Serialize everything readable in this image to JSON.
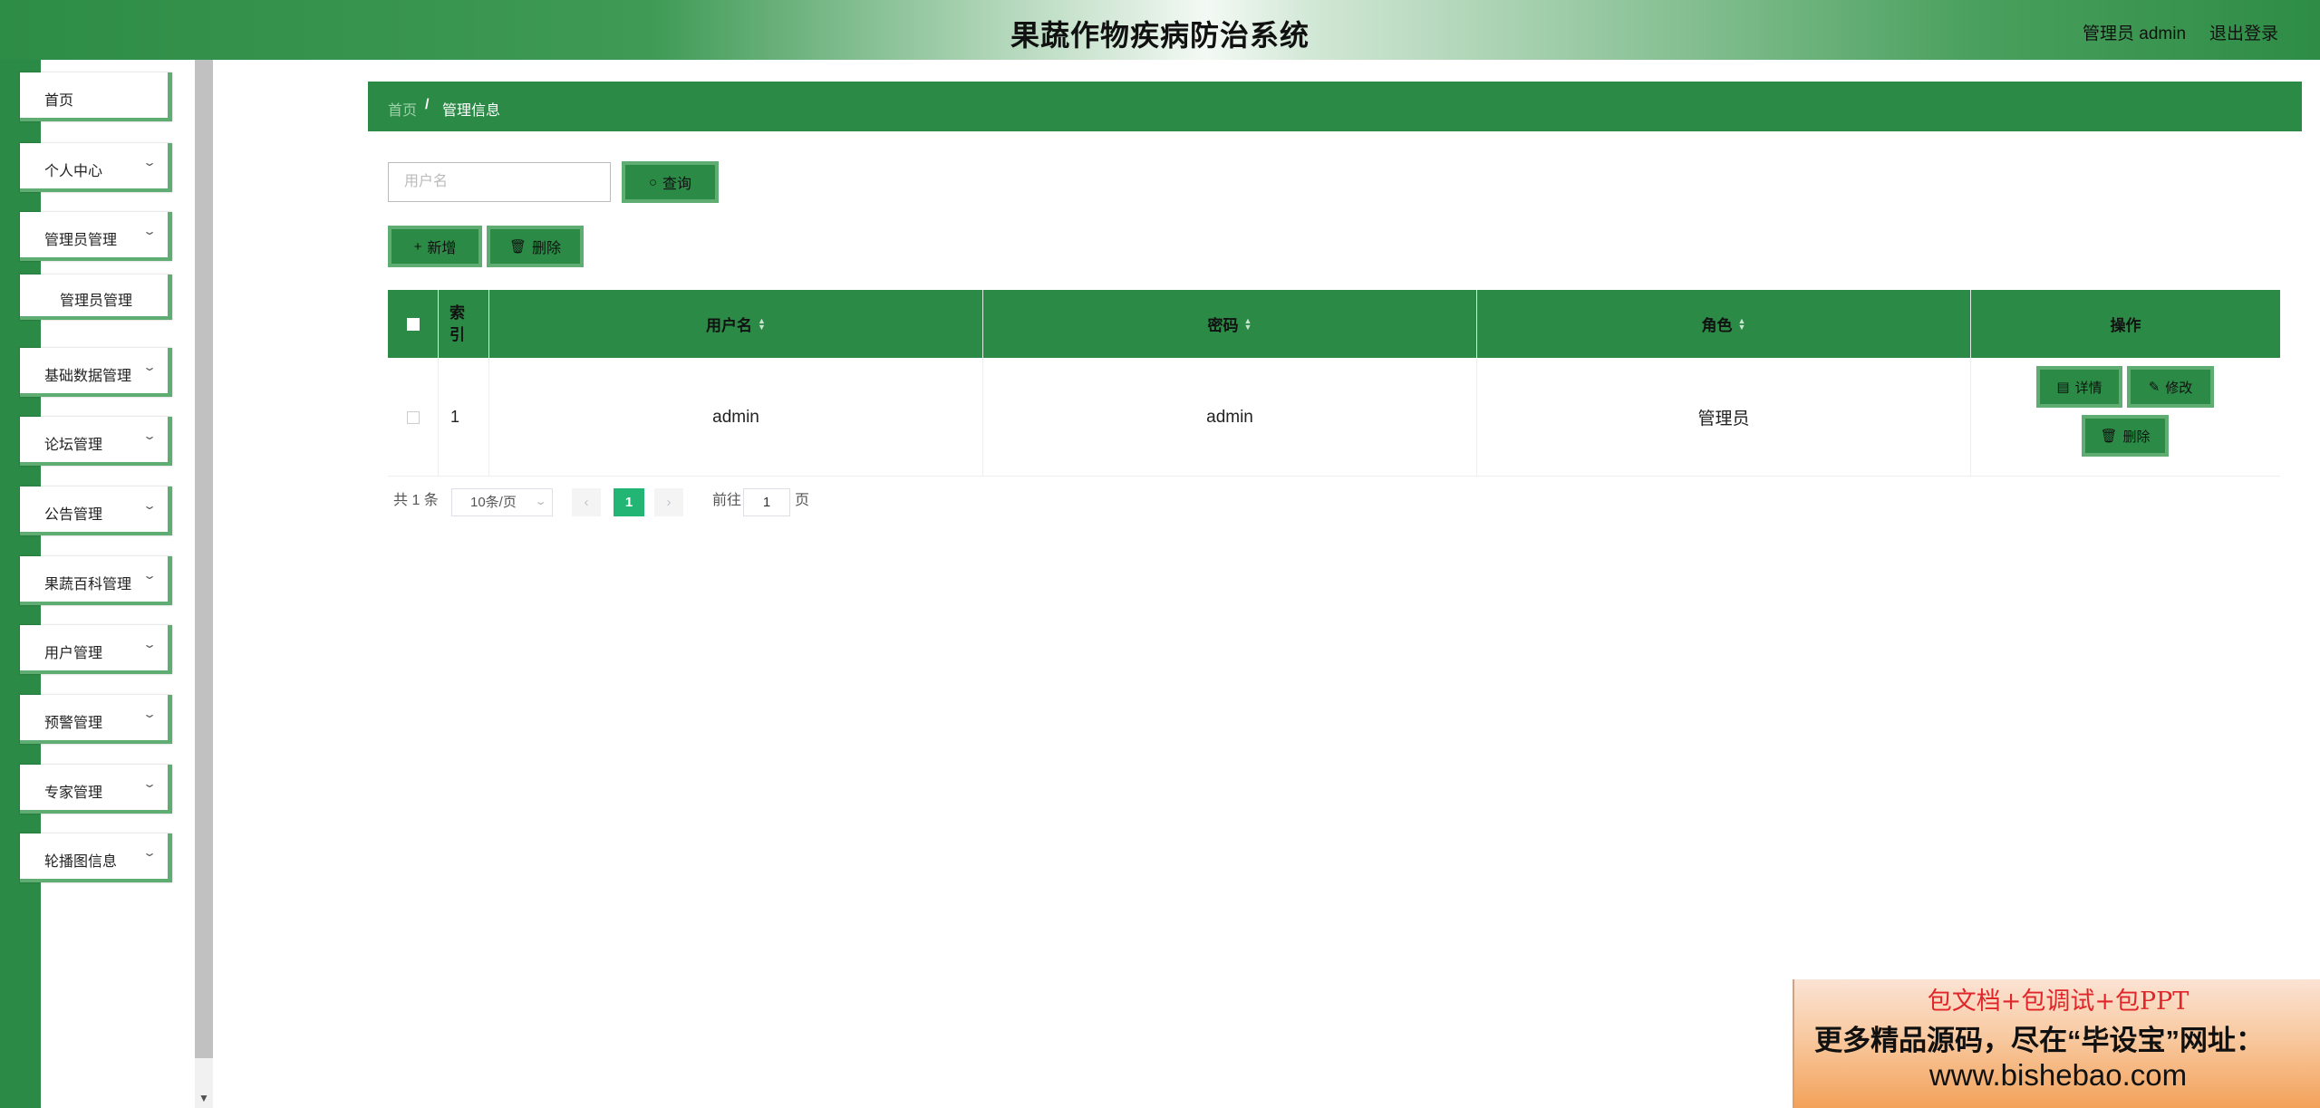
{
  "header": {
    "title": "果蔬作物疾病防治系统",
    "user": "管理员 admin",
    "logout": "退出登录"
  },
  "sidebar": {
    "items": [
      {
        "label": "首页",
        "expandable": false
      },
      {
        "label": "个人中心",
        "expandable": true
      },
      {
        "label": "管理员管理",
        "expandable": true
      },
      {
        "label": "管理员管理",
        "sub": true
      },
      {
        "label": "基础数据管理",
        "expandable": true
      },
      {
        "label": "论坛管理",
        "expandable": true
      },
      {
        "label": "公告管理",
        "expandable": true
      },
      {
        "label": "果蔬百科管理",
        "expandable": true
      },
      {
        "label": "用户管理",
        "expandable": true
      },
      {
        "label": "预警管理",
        "expandable": true
      },
      {
        "label": "专家管理",
        "expandable": true
      },
      {
        "label": "轮播图信息",
        "expandable": true
      }
    ]
  },
  "breadcrumb": {
    "home": "首页",
    "separator": "/",
    "current": "管理信息"
  },
  "search": {
    "placeholder": "用户名",
    "value": "",
    "button": "查询"
  },
  "toolbar": {
    "add": "新增",
    "delete": "删除"
  },
  "table": {
    "columns": {
      "index": "索引",
      "username": "用户名",
      "password": "密码",
      "role": "角色",
      "actions": "操作"
    },
    "rows": [
      {
        "index": "1",
        "username": "admin",
        "password": "admin",
        "role": "管理员"
      }
    ],
    "row_actions": {
      "detail": "详情",
      "edit": "修改",
      "delete": "删除"
    }
  },
  "pagination": {
    "total": "共 1 条",
    "page_size": "10条/页",
    "current_page": "1",
    "goto_label": "前往",
    "goto_value": "1",
    "page_suffix": "页"
  },
  "promo": {
    "line1": "包文档+包调试+包PPT",
    "line2": "更多精品源码，尽在“毕设宝”网址：",
    "line3": "www.bishebao.com"
  },
  "colors": {
    "primary": "#2b8a46",
    "accent_border": "#5fad72",
    "page_active": "#22b573",
    "promo_red": "#e0262a"
  },
  "icons": {
    "search": "search-icon",
    "add": "plus-icon",
    "delete": "trash-icon",
    "detail": "document-icon",
    "edit": "edit-icon",
    "expand": "chevron-down-icon"
  }
}
